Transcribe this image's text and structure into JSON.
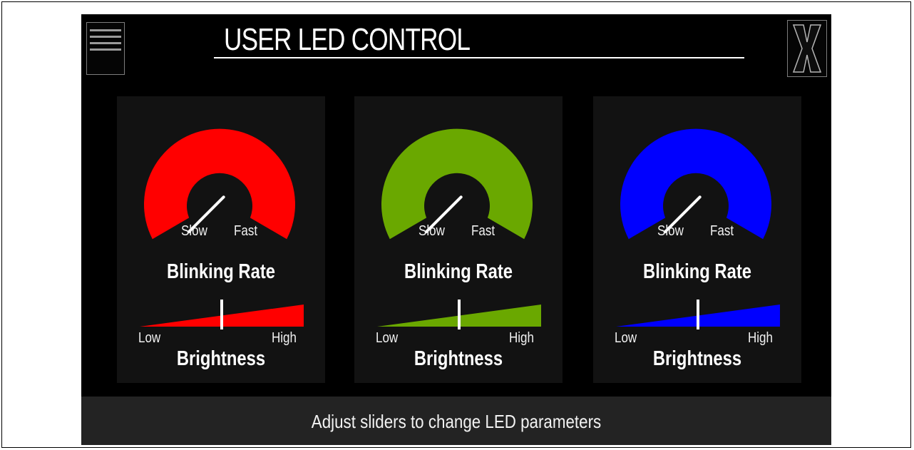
{
  "header": {
    "title": "USER LED CONTROL",
    "menu_icon": "hamburger-menu-icon",
    "close_label": "X"
  },
  "panels": [
    {
      "color": "#ff0000",
      "rate": {
        "min_label": "Slow",
        "max_label": "Fast",
        "title": "Blinking Rate",
        "value": 0.0
      },
      "brightness": {
        "min_label": "Low",
        "max_label": "High",
        "title": "Brightness",
        "value": 0.5
      }
    },
    {
      "color": "#6aa800",
      "rate": {
        "min_label": "Slow",
        "max_label": "Fast",
        "title": "Blinking Rate",
        "value": 0.0
      },
      "brightness": {
        "min_label": "Low",
        "max_label": "High",
        "title": "Brightness",
        "value": 0.5
      }
    },
    {
      "color": "#0000ff",
      "rate": {
        "min_label": "Slow",
        "max_label": "Fast",
        "title": "Blinking Rate",
        "value": 0.0
      },
      "brightness": {
        "min_label": "Low",
        "max_label": "High",
        "title": "Brightness",
        "value": 0.5
      }
    }
  ],
  "status": {
    "message": "Adjust sliders to change LED parameters"
  }
}
